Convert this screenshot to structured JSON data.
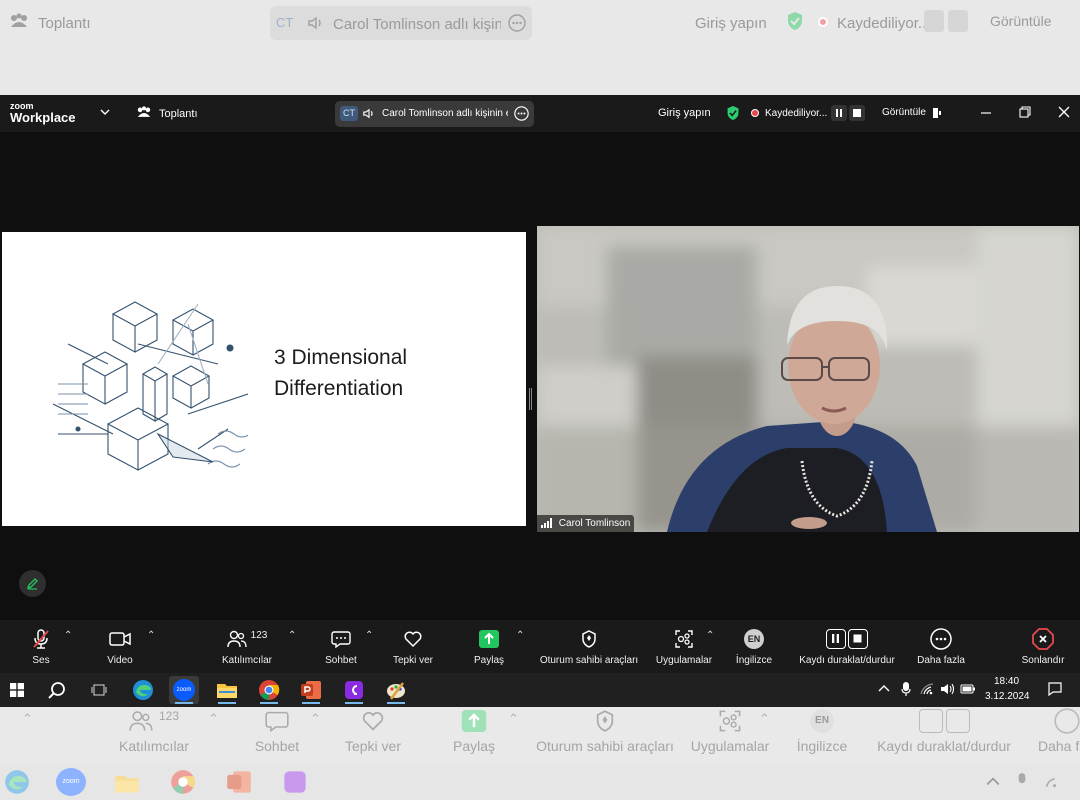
{
  "bg_top": {
    "meeting": "Toplantı",
    "chip_initials": "CT",
    "chip_text": "Carol Tomlinson adlı kişinin e",
    "signin": "Giriş yapın",
    "recording": "Kaydediliyor...",
    "view": "Görüntüle"
  },
  "titlebar": {
    "logo_small": "zoom",
    "logo_big": "Workplace",
    "meeting": "Toplantı",
    "chip_initials": "CT",
    "chip_text": "Carol Tomlinson adlı kişinin e",
    "signin": "Giriş yapın",
    "recording": "Kaydediliyor...",
    "view": "Görüntüle"
  },
  "slide": {
    "title_line1": "3 Dimensional",
    "title_line2": "Differentiation"
  },
  "video": {
    "participant": "Carol Tomlinson"
  },
  "toolbar": {
    "audio": "Ses",
    "video": "Video",
    "participants": "Katılımcılar",
    "participant_count": "123",
    "chat": "Sohbet",
    "react": "Tepki ver",
    "share": "Paylaş",
    "host_tools": "Oturum sahibi araçları",
    "apps": "Uygulamalar",
    "language_badge": "EN",
    "language": "İngilizce",
    "record": "Kaydı duraklat/durdur",
    "more": "Daha fazla",
    "end": "Sonlandır"
  },
  "taskbar": {
    "zoom_label": "zoom",
    "time": "18:40",
    "date": "3.12.2024"
  },
  "bg_bottom": {
    "participants": "Katılımcılar",
    "participant_count": "123",
    "chat": "Sohbet",
    "react": "Tepki ver",
    "share": "Paylaş",
    "host_tools": "Oturum sahibi araçları",
    "apps": "Uygulamalar",
    "language_badge": "EN",
    "language": "İngilizce",
    "record": "Kaydı duraklat/durdur",
    "more": "Daha fazla",
    "zoom_label": "zoom"
  },
  "colors": {
    "share_green": "#22c55e",
    "shield_green": "#2ecc71",
    "end_red": "#e5484d",
    "record_red": "#e5484d"
  }
}
